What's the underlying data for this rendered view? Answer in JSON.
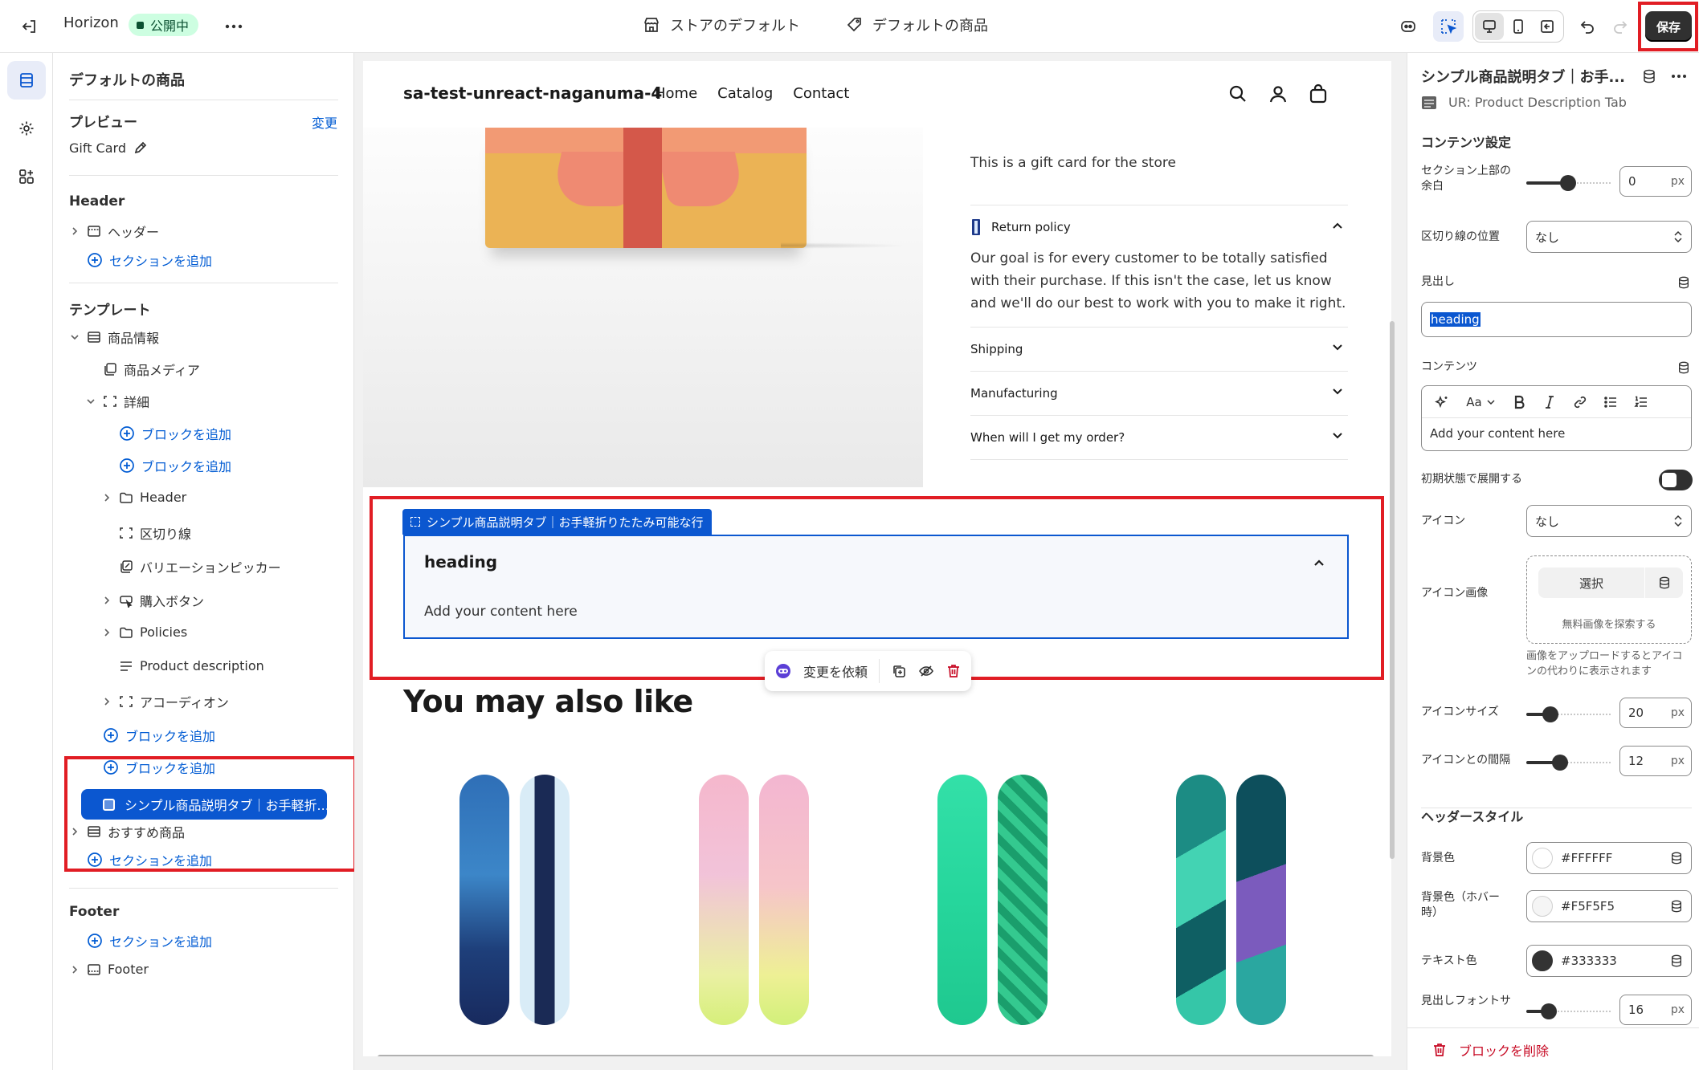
{
  "topbar": {
    "theme_name": "Horizon",
    "status_badge": "公開中",
    "store_default": "ストアのデフォルト",
    "default_product": "デフォルトの商品",
    "save": "保存"
  },
  "left": {
    "title": "デフォルトの商品",
    "preview_label": "プレビュー",
    "preview_change": "変更",
    "preview_value": "Gift Card",
    "header_group": "Header",
    "header_item": "ヘッダー",
    "add_section_1": "セクションを追加",
    "template_group": "テンプレート",
    "items": [
      {
        "label": "商品情報"
      },
      {
        "label": "商品メディア"
      },
      {
        "label": "詳細"
      },
      {
        "label": "ブロックを追加"
      },
      {
        "label": "ブロックを追加"
      },
      {
        "label": "Header"
      },
      {
        "label": "区切り線"
      },
      {
        "label": "バリエーションピッカー"
      },
      {
        "label": "購入ボタン"
      },
      {
        "label": "Policies"
      },
      {
        "label": "Product description"
      },
      {
        "label": "アコーディオン"
      },
      {
        "label": "ブロックを追加"
      },
      {
        "label": "ブロックを追加"
      }
    ],
    "selected_item": "シンプル商品説明タブ｜お手軽折...",
    "recommended": "おすすめ商品",
    "add_section_2": "セクションを追加",
    "footer_group": "Footer",
    "add_section_3": "セクションを追加",
    "footer_item": "Footer"
  },
  "preview": {
    "store_name": "sa-test-unreact-naganuma-4",
    "nav": [
      "Home",
      "Catalog",
      "Contact"
    ],
    "product_description": "This is a gift card for the store",
    "accordions": [
      {
        "title": "Return policy",
        "open": true
      },
      {
        "title": "Shipping",
        "open": false
      },
      {
        "title": "Manufacturing",
        "open": false
      },
      {
        "title": "When will I get my order?",
        "open": false
      }
    ],
    "return_policy_body": "Our goal is for every customer to be totally satisfied with their purchase. If this isn't the case, let us know and we'll do our best to work with you to make it right.",
    "section_tag": "シンプル商品説明タブ｜お手軽折りたたみ可能な行",
    "section_heading": "heading",
    "section_content": "Add your content here",
    "float_request": "変更を依頼",
    "you_may_also_like": "You may also like"
  },
  "right": {
    "title": "シンプル商品説明タブ｜お手...",
    "subtitle": "UR: Product Description Tab",
    "content_settings": "コンテンツ設定",
    "top_margin_label": "セクション上部の余白",
    "top_margin_value": "0",
    "unit": "px",
    "divider_pos_label": "区切り線の位置",
    "divider_pos_value": "なし",
    "heading_label": "見出し",
    "heading_value": "heading",
    "content_label": "コンテンツ",
    "content_aa": "Aa",
    "content_placeholder": "Add your content here",
    "expanded_label": "初期状態で展開する",
    "expanded_value": false,
    "icon_label": "アイコン",
    "icon_value": "なし",
    "icon_image_label": "アイコン画像",
    "select_label": "選択",
    "explore_free": "無料画像を探索する",
    "upload_hint": "画像をアップロードするとアイコンの代わりに表示されます",
    "icon_size_label": "アイコンサイズ",
    "icon_size_value": "20",
    "icon_gap_label": "アイコンとの間隔",
    "icon_gap_value": "12",
    "header_style": "ヘッダースタイル",
    "bg_label": "背景色",
    "bg_value": "#FFFFFF",
    "bg_hover_label": "背景色（ホバー時）",
    "bg_hover_value": "#F5F5F5",
    "text_color_label": "テキスト色",
    "text_color_value": "#333333",
    "heading_size_label": "見出しフォントサイズ",
    "heading_size_value": "16",
    "delete_block": "ブロックを削除"
  },
  "colors": {
    "accent": "#005BD3",
    "selected": "#0B57D0",
    "highlight_frame": "#E11D24",
    "delete": "#C70A24"
  }
}
